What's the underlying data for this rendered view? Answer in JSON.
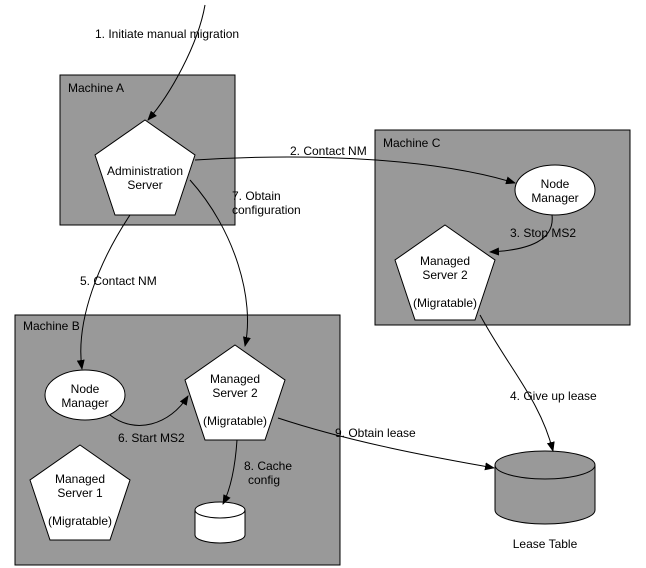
{
  "machines": {
    "a": {
      "label": "Machine A"
    },
    "b": {
      "label": "Machine B"
    },
    "c": {
      "label": "Machine C"
    }
  },
  "nodes": {
    "admin_server": {
      "line1": "Administration",
      "line2": "Server"
    },
    "nm_a": "",
    "nm_b": {
      "line1": "Node",
      "line2": "Manager"
    },
    "nm_c": {
      "line1": "Node",
      "line2": "Manager"
    },
    "ms1": {
      "line1": "Managed",
      "line2": "Server 1",
      "line3": "(Migratable)"
    },
    "ms2_b": {
      "line1": "Managed",
      "line2": "Server 2",
      "line3": "(Migratable)"
    },
    "ms2_c": {
      "line1": "Managed",
      "line2": "Server 2",
      "line3": "(Migratable)"
    },
    "cache": "",
    "lease_table": {
      "label": "Lease Table"
    }
  },
  "steps": {
    "s1": "1. Initiate manual migration",
    "s2": "2. Contact NM",
    "s3": "3. Stop MS2",
    "s4": "4. Give up lease",
    "s5": "5. Contact NM",
    "s6": "6. Start MS2",
    "s7a": "7. Obtain",
    "s7b": "configuration",
    "s8a": "8. Cache",
    "s8b": "config",
    "s9": "9.  Obtain lease"
  }
}
